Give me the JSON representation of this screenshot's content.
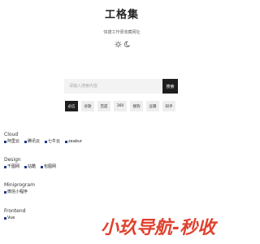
{
  "header": {
    "title": "工格集",
    "subtitle": "快捷工作便收藏网址"
  },
  "theme_toggle": {
    "light_icon": "sun-icon",
    "dark_icon": "moon-icon"
  },
  "search": {
    "placeholder": "请输入搜索内容",
    "button_label": "搜索"
  },
  "engines": [
    {
      "label": "必应",
      "active": true
    },
    {
      "label": "谷歌",
      "active": false
    },
    {
      "label": "百度",
      "active": false
    },
    {
      "label": "360",
      "active": false
    },
    {
      "label": "搜狗",
      "active": false
    },
    {
      "label": "豆瓣",
      "active": false
    },
    {
      "label": "知乎",
      "active": false
    }
  ],
  "sections": [
    {
      "title": "Cloud",
      "links": [
        "阿里云",
        "腾讯云",
        "七牛云",
        "zeabur"
      ]
    },
    {
      "title": "Design",
      "links": [
        "千图网",
        "站酷",
        "包图网"
      ]
    },
    {
      "title": "Miniprogram",
      "links": [
        "微信小程序"
      ]
    },
    {
      "title": "Frontend",
      "links": [
        "Vue"
      ]
    }
  ],
  "watermark": {
    "text": "小玖导航-秒收",
    "color": "#e0412e"
  }
}
